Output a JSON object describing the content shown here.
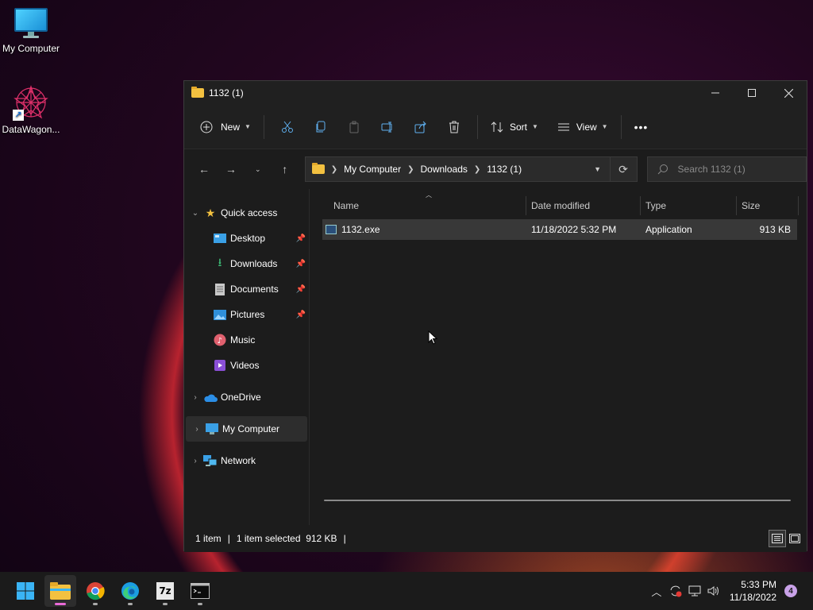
{
  "desktop": {
    "icons": [
      {
        "label": "My Computer",
        "icon": "monitor-icon"
      },
      {
        "label": "DataWagon...",
        "icon": "datawagon-icon"
      }
    ]
  },
  "window": {
    "title": "1132 (1)",
    "controls": {
      "minimize": "—",
      "maximize": "☐",
      "close": "✕"
    },
    "toolbar": {
      "new_label": "New",
      "sort_label": "Sort",
      "view_label": "View",
      "more_label": "•••"
    },
    "address": {
      "crumbs": [
        "My Computer",
        "Downloads",
        "1132 (1)"
      ]
    },
    "search": {
      "placeholder": "Search 1132 (1)"
    },
    "nav": {
      "quick_access": "Quick access",
      "items": [
        {
          "label": "Desktop",
          "pinned": true
        },
        {
          "label": "Downloads",
          "pinned": true
        },
        {
          "label": "Documents",
          "pinned": true
        },
        {
          "label": "Pictures",
          "pinned": true
        },
        {
          "label": "Music"
        },
        {
          "label": "Videos"
        }
      ],
      "onedrive": "OneDrive",
      "my_computer": "My Computer",
      "network": "Network"
    },
    "columns": {
      "name": "Name",
      "date": "Date modified",
      "type": "Type",
      "size": "Size"
    },
    "files": [
      {
        "name": "1132.exe",
        "date": "11/18/2022 5:32 PM",
        "type": "Application",
        "size": "913 KB"
      }
    ],
    "status": {
      "count": "1 item",
      "selected": "1 item selected  912 KB"
    }
  },
  "taskbar": {
    "apps": [
      "start-icon",
      "file-explorer-icon",
      "chrome-icon",
      "edge-icon",
      "7zip-icon",
      "terminal-icon"
    ],
    "sevenzip_label": "7z",
    "clock_time": "5:33 PM",
    "clock_date": "11/18/2022",
    "notification_count": "4"
  },
  "colors": {
    "accent": "#e86ad7",
    "folder": "#f3c140",
    "window_bg": "#1c1c1c",
    "taskbar_bg": "#1b1b1b"
  }
}
